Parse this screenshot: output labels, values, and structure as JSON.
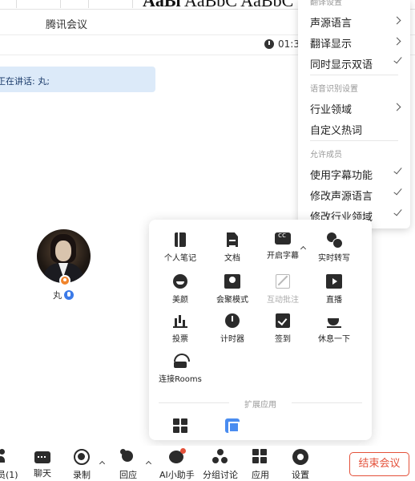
{
  "window": {
    "title": "腾讯会议"
  },
  "doc_toolbar": {
    "style_preview_1": "AaBl",
    "style_preview_2": "AaBbC AaBbC"
  },
  "timer": {
    "text": "01:3"
  },
  "speaker": {
    "text": "正在讲话: 丸;"
  },
  "participant": {
    "name": "丸"
  },
  "menu": {
    "section_1": "翻译设置",
    "items_1": [
      {
        "label": "声源语言",
        "type": "submenu"
      },
      {
        "label": "翻译显示",
        "type": "submenu"
      },
      {
        "label": "同时显示双语",
        "type": "check"
      }
    ],
    "section_2": "语音识别设置",
    "items_2": [
      {
        "label": "行业领域",
        "type": "submenu"
      },
      {
        "label": "自定义热词",
        "type": "none"
      }
    ],
    "section_3": "允许成员",
    "items_3": [
      {
        "label": "使用字幕功能",
        "type": "check"
      },
      {
        "label": "修改声源语言",
        "type": "check"
      },
      {
        "label": "修改行业领域",
        "type": "check"
      }
    ]
  },
  "apps_panel": {
    "apps": [
      {
        "label": "个人笔记",
        "icon": "notebook-icon"
      },
      {
        "label": "文档",
        "icon": "document-icon"
      },
      {
        "label": "开启字幕",
        "icon": "caption-icon"
      },
      {
        "label": "实时转写",
        "icon": "transcribe-icon"
      },
      {
        "label": "美颜",
        "icon": "beauty-icon"
      },
      {
        "label": "会聚模式",
        "icon": "gallery-icon"
      },
      {
        "label": "互动批注",
        "icon": "annotation-icon",
        "disabled": true
      },
      {
        "label": "直播",
        "icon": "live-icon"
      },
      {
        "label": "投票",
        "icon": "vote-icon"
      },
      {
        "label": "计时器",
        "icon": "timer-icon"
      },
      {
        "label": "签到",
        "icon": "sign-in-icon"
      },
      {
        "label": "休息一下",
        "icon": "coffee-icon"
      },
      {
        "label": "连接Rooms",
        "icon": "rooms-icon"
      }
    ],
    "extension_title": "扩展应用"
  },
  "toolbar": {
    "members": "员(1)",
    "chat": "聊天",
    "record": "录制",
    "react": "回应",
    "ai": "AI小助手",
    "breakout": "分组讨论",
    "apps": "应用",
    "settings": "设置",
    "end": "结束会议"
  },
  "colors": {
    "accent": "#3b7ae8",
    "end_red": "#e4513a",
    "speaker_bg": "#dceaf9",
    "host_badge": "#f0842c"
  }
}
